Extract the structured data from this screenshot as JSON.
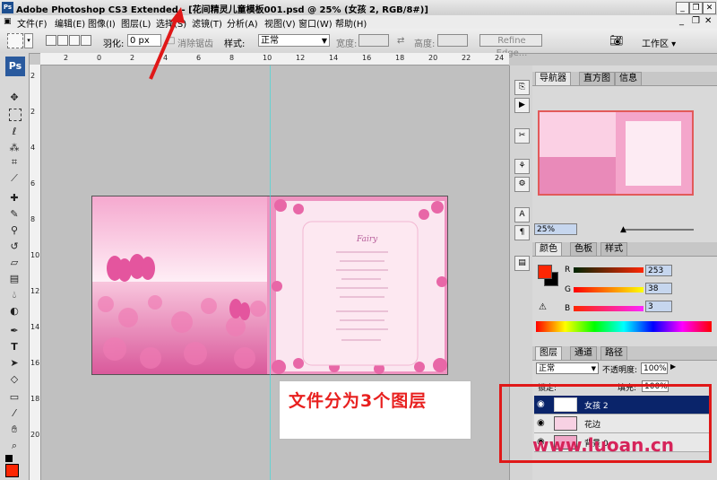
{
  "window": {
    "app_icon": "Ps",
    "title": "Adobe Photoshop CS3 Extended - [花间精灵儿童模板001.psd @ 25% (女孩 2, RGB/8#)]",
    "minimize": "_",
    "restore": "❐",
    "close": "✕"
  },
  "menu": [
    "文件(F)",
    "编辑(E)",
    "图像(I)",
    "图层(L)",
    "选择(S)",
    "滤镜(T)",
    "分析(A)",
    "视图(V)",
    "窗口(W)",
    "帮助(H)"
  ],
  "options": {
    "feather_label": "羽化:",
    "feather_value": "0 px",
    "anti_alias_label": "消除锯齿",
    "style_label": "样式:",
    "style_value": "正常",
    "width_label": "宽度:",
    "height_label": "高度:",
    "refine_edge": "Refine Edge...",
    "workspace": "工作区 ▾"
  },
  "toolbox": {
    "logo": "Ps"
  },
  "ruler_h": [
    "2",
    "0",
    "2",
    "4",
    "6",
    "8",
    "10",
    "12",
    "14",
    "16",
    "18",
    "20",
    "22",
    "24"
  ],
  "ruler_v": [
    "2",
    "2",
    "4",
    "6",
    "8",
    "10",
    "12",
    "14",
    "16",
    "18",
    "20"
  ],
  "annotation": {
    "note": "文件分为3个图层"
  },
  "navigator": {
    "tabs": [
      "导航器",
      "直方图",
      "信息"
    ],
    "zoom": "25%"
  },
  "color_panel": {
    "tabs": [
      "颜色",
      "色板",
      "样式"
    ],
    "r_label": "R",
    "r_value": "253",
    "g_label": "G",
    "g_value": "38",
    "b_label": "B",
    "b_value": "3",
    "foreground_color": "#fd2603"
  },
  "layers_panel": {
    "tabs": [
      "图层",
      "通道",
      "路径"
    ],
    "blend_mode": "正常",
    "opacity_label": "不透明度:",
    "opacity_value": "100%",
    "lock_label": "锁定:",
    "fill_label": "填充:",
    "fill_value": "100%",
    "layers": [
      {
        "name": "女孩 2",
        "selected": true
      },
      {
        "name": "花边",
        "selected": false
      },
      {
        "name": "背景 0",
        "selected": false
      }
    ]
  },
  "watermark": "www.luoan.cn",
  "colors": {
    "highlight": "#e01818",
    "selected_layer": "#0a246a",
    "accent": "#2a5a9e"
  }
}
